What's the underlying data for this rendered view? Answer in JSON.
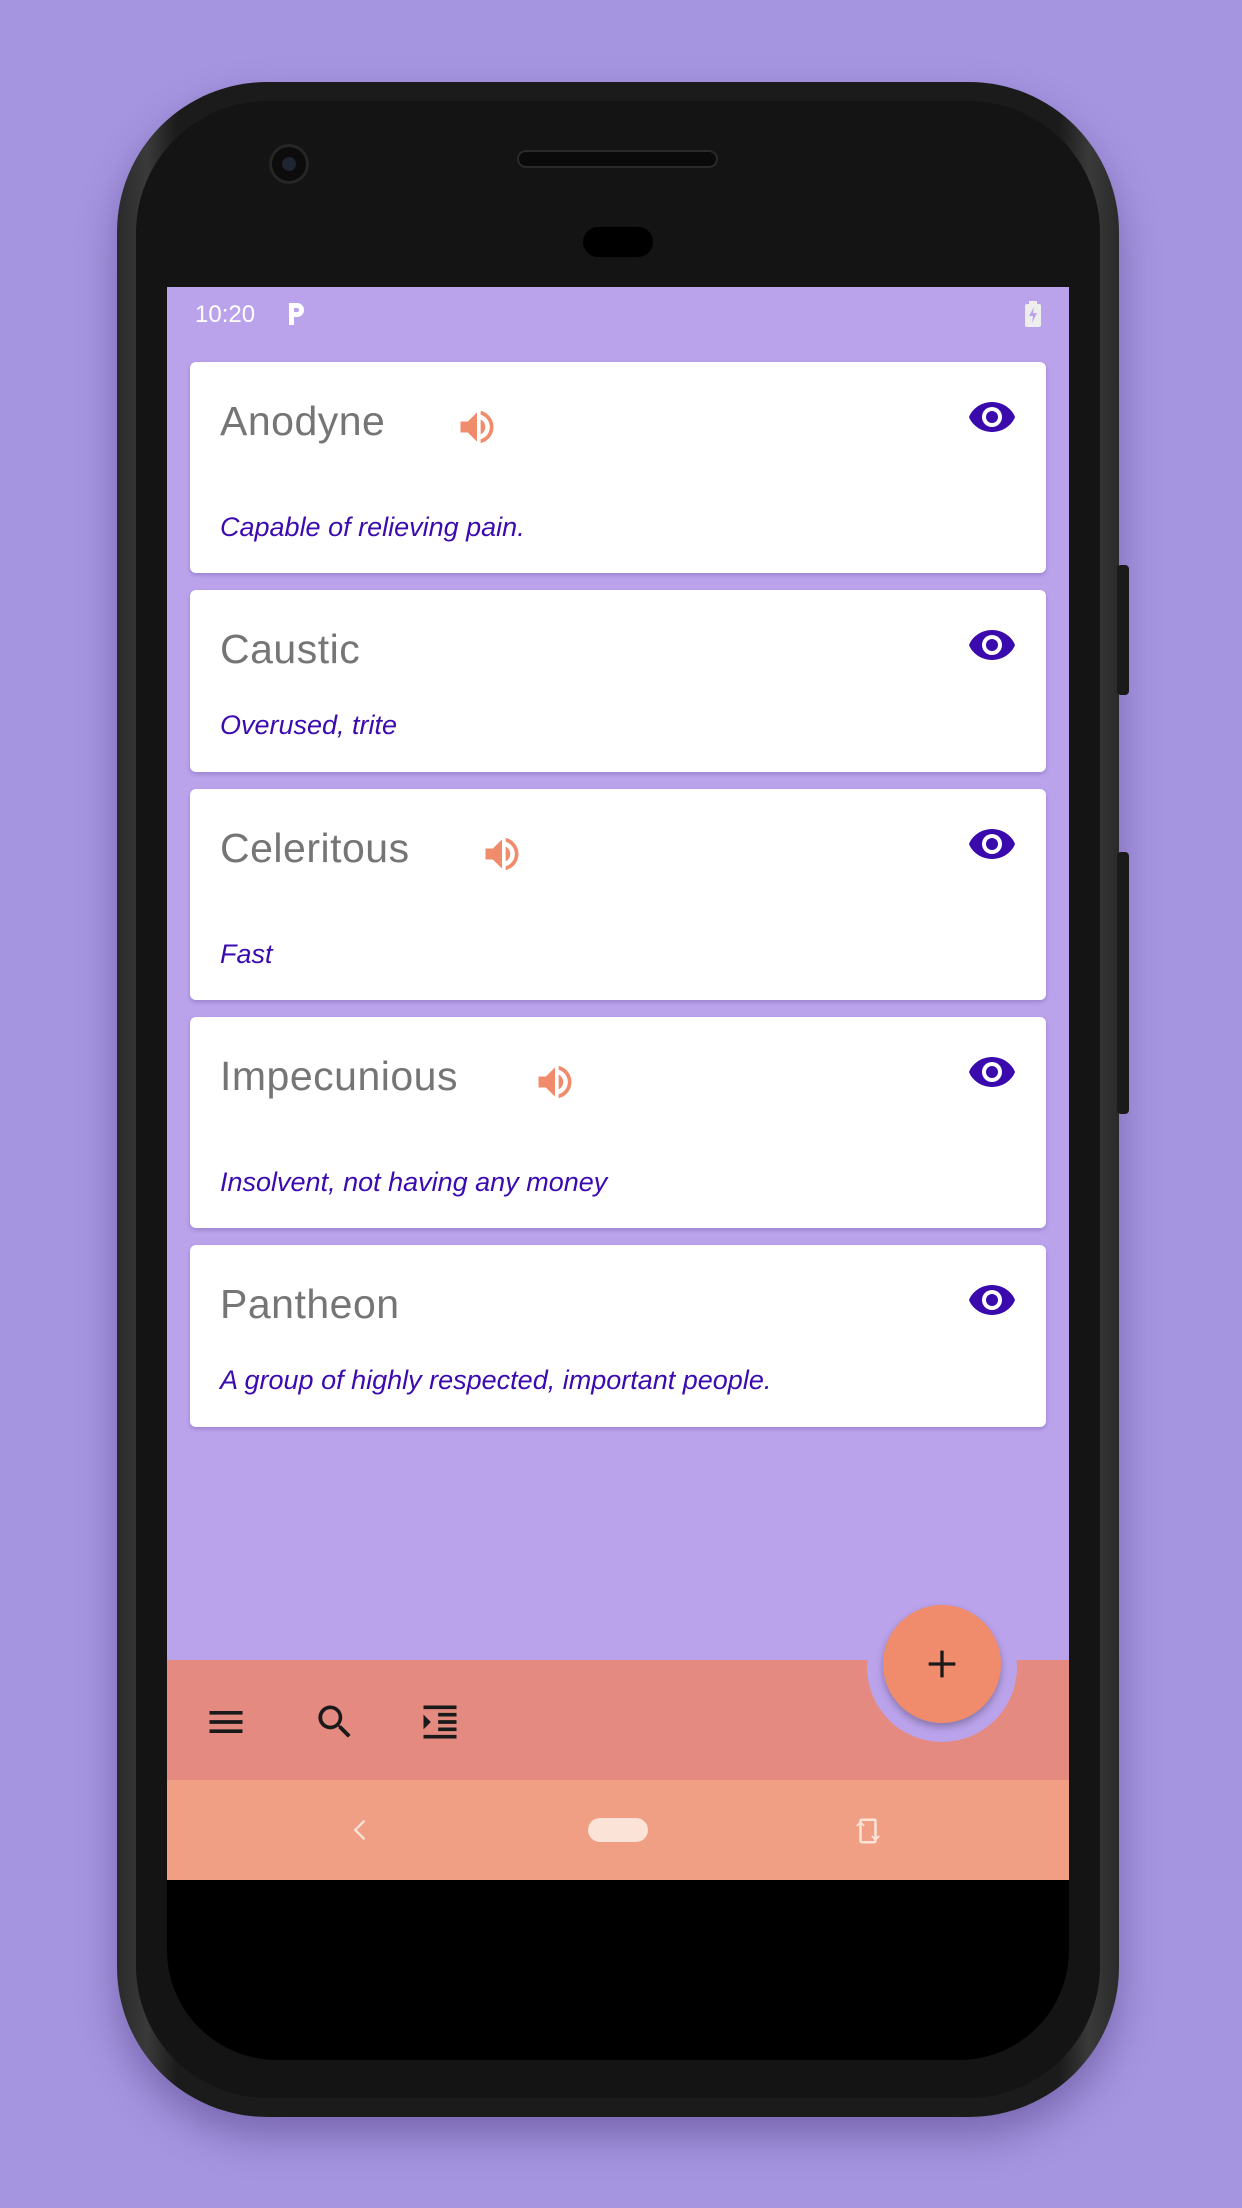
{
  "status_bar": {
    "time": "10:20",
    "notification_icon": "parking-p-icon",
    "battery_icon": "battery-charging-icon"
  },
  "words": [
    {
      "word": "Anodyne",
      "definition": "Capable of relieving pain.",
      "has_audio": true
    },
    {
      "word": "Caustic",
      "definition": "Overused, trite",
      "has_audio": false
    },
    {
      "word": "Celeritous",
      "definition": "Fast",
      "has_audio": true
    },
    {
      "word": "Impecunious",
      "definition": "Insolvent, not having any money",
      "has_audio": true
    },
    {
      "word": "Pantheon",
      "definition": "A group of highly respected, important people.",
      "has_audio": false
    }
  ],
  "icons": {
    "audio": "volume-up-icon",
    "reveal": "eye-icon"
  },
  "bottom_bar": {
    "menu_icon": "menu-icon",
    "search_icon": "search-icon",
    "indent_icon": "format-indent-icon",
    "fab_icon": "plus-icon"
  },
  "nav_bar": {
    "back_icon": "back-chevron-icon",
    "home_icon": "home-pill-icon",
    "rotate_icon": "rotate-screen-icon"
  },
  "colors": {
    "background": "#a595e0",
    "screen_background": "#bba3ec",
    "word_text": "#757575",
    "definition_text": "#3b0bb0",
    "eye_icon": "#3a0aac",
    "speaker_icon": "#f08c6c",
    "bottom_bar": "#e58a80",
    "fab": "#f08c6c",
    "nav_bar": "#f09e84"
  }
}
